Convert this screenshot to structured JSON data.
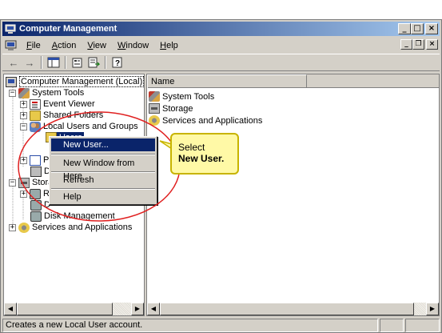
{
  "window": {
    "title": "Computer Management"
  },
  "title_buttons": {
    "minimize": "_",
    "maximize": "□",
    "close": "×"
  },
  "mdi_buttons": {
    "minimize": "_",
    "restore": "❐",
    "close": "×"
  },
  "menubar": {
    "items": [
      {
        "label": "File",
        "underline": "F",
        "rest": "ile"
      },
      {
        "label": "Action",
        "underline": "A",
        "rest": "ction"
      },
      {
        "label": "View",
        "underline": "V",
        "rest": "iew"
      },
      {
        "label": "Window",
        "underline": "W",
        "rest": "indow"
      },
      {
        "label": "Help",
        "underline": "H",
        "rest": "elp"
      }
    ]
  },
  "toolbar": {
    "back_glyph": "←",
    "forward_glyph": "→",
    "icons": [
      "back-arrow-icon",
      "forward-arrow-icon",
      "show-hide-tree-icon",
      "properties-icon",
      "export-list-icon",
      "help-icon"
    ]
  },
  "tree": {
    "root": "Computer Management (Local)",
    "system_tools": "System Tools",
    "event_viewer": "Event Viewer",
    "shared_folders": "Shared Folders",
    "local_users_groups": "Local Users and Groups",
    "users": "Users",
    "perf_partial": "P",
    "device_partial": "D",
    "storage": "Storage",
    "removable_partial": "R",
    "defrag_partial": "D",
    "disk_management": "Disk Management",
    "services_apps": "Services and Applications",
    "expand_plus": "+",
    "expand_minus": "−"
  },
  "list": {
    "column_name": "Name",
    "items": [
      "System Tools",
      "Storage",
      "Services and Applications"
    ]
  },
  "context_menu": {
    "new_user": "New User...",
    "new_window": "New Window from Here",
    "refresh": "Refresh",
    "help": "Help"
  },
  "callout": {
    "line1": "Select",
    "line2": "New User."
  },
  "statusbar": {
    "text": "Creates a new Local User account."
  },
  "scroll": {
    "left": "◀",
    "right": "▶"
  },
  "colors": {
    "title_start": "#0a246a",
    "title_end": "#a6caf0",
    "selection": "#0a246a",
    "annotation": "#e02020",
    "callout_bg": "#fff9a6"
  }
}
